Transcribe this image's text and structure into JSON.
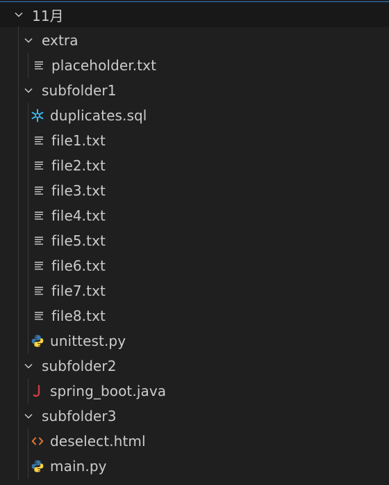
{
  "explorer": {
    "root": {
      "label": "11月",
      "expanded": true
    },
    "folders": [
      {
        "label": "extra",
        "files": [
          {
            "label": "placeholder.txt",
            "icon": "text-file-icon"
          }
        ]
      },
      {
        "label": "subfolder1",
        "files": [
          {
            "label": "duplicates.sql",
            "icon": "sql-icon"
          },
          {
            "label": "file1.txt",
            "icon": "text-file-icon"
          },
          {
            "label": "file2.txt",
            "icon": "text-file-icon"
          },
          {
            "label": "file3.txt",
            "icon": "text-file-icon"
          },
          {
            "label": "file4.txt",
            "icon": "text-file-icon"
          },
          {
            "label": "file5.txt",
            "icon": "text-file-icon"
          },
          {
            "label": "file6.txt",
            "icon": "text-file-icon"
          },
          {
            "label": "file7.txt",
            "icon": "text-file-icon"
          },
          {
            "label": "file8.txt",
            "icon": "text-file-icon"
          },
          {
            "label": "unittest.py",
            "icon": "python-icon"
          }
        ]
      },
      {
        "label": "subfolder2",
        "files": [
          {
            "label": "spring_boot.java",
            "icon": "java-icon"
          }
        ]
      },
      {
        "label": "subfolder3",
        "files": [
          {
            "label": "deselect.html",
            "icon": "html-icon"
          },
          {
            "label": "main.py",
            "icon": "python-icon"
          }
        ]
      }
    ],
    "colors": {
      "background": "#1f1f1f",
      "root_background": "#181818",
      "focus_border": "#2b79d0",
      "text": "#cccccc",
      "guide": "#3a3a3a",
      "sql_icon": "#3fb6e8",
      "python_blue": "#3776ab",
      "python_yellow": "#ffd43b",
      "java_icon": "#cc3e44",
      "html_icon": "#e37933"
    }
  }
}
